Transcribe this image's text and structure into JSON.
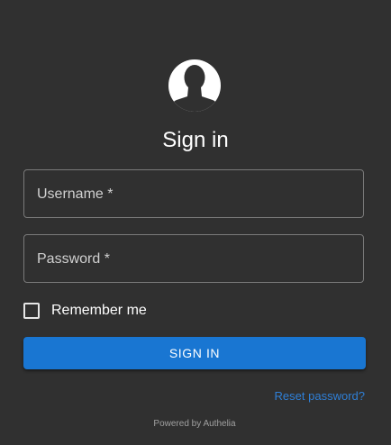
{
  "icons": {
    "avatar": "user-circle-icon"
  },
  "colors": {
    "background": "#303030",
    "primary": "#1976d2",
    "link": "#2f7fd6"
  },
  "login": {
    "title": "Sign in",
    "username_label": "Username *",
    "password_label": "Password *",
    "remember_label": "Remember me",
    "remember_checked": false,
    "signin_button": "SIGN IN",
    "reset_link": "Reset password?"
  },
  "footer": {
    "powered_by": "Powered by Authelia"
  }
}
